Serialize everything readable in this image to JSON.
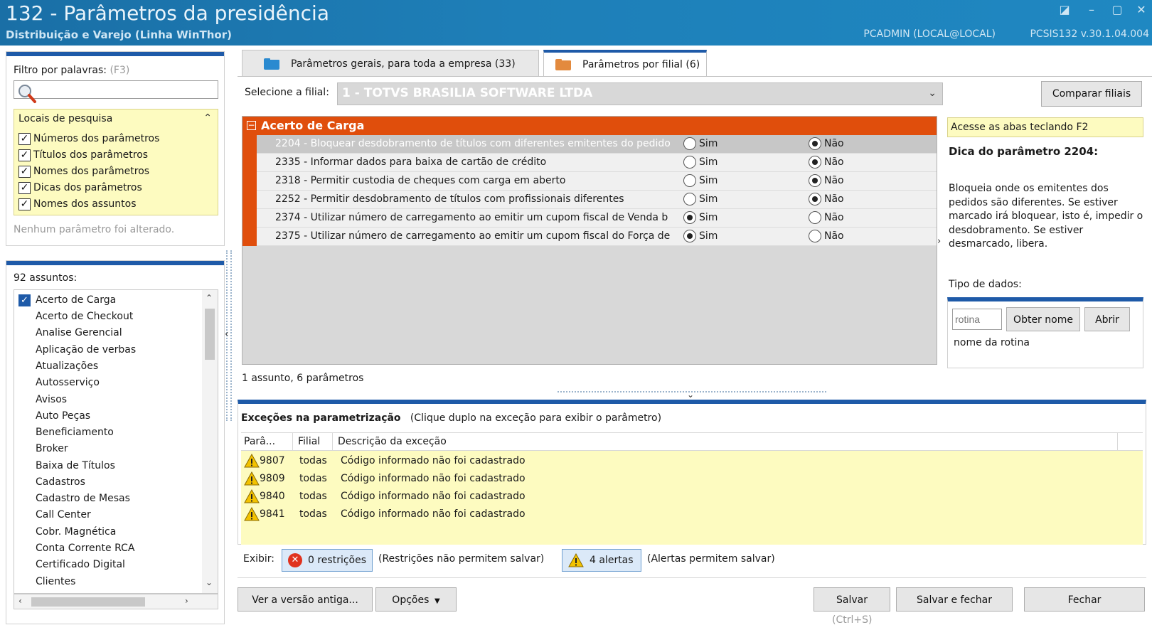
{
  "window": {
    "title": "132 - Parâmetros da presidência",
    "subtitle": "Distribuição e Varejo (Linha WinThor)",
    "user": "PCADMIN (LOCAL@LOCAL)",
    "version": "PCSIS132  v.30.1.04.004"
  },
  "filter": {
    "label": "Filtro por palavras:",
    "hint": "(F3)",
    "search_value": "",
    "locais_title": "Locais de pesquisa",
    "options": [
      {
        "label": "Números dos parâmetros",
        "checked": true
      },
      {
        "label": "Títulos dos parâmetros",
        "checked": true
      },
      {
        "label": "Nomes dos parâmetros",
        "checked": true
      },
      {
        "label": "Dicas dos parâmetros",
        "checked": true
      },
      {
        "label": "Nomes dos assuntos",
        "checked": true
      }
    ],
    "no_change": "Nenhum parâmetro foi alterado."
  },
  "assuntos": {
    "count_label": "92 assuntos:",
    "items": [
      "Acerto de Carga",
      "Acerto de Checkout",
      "Analise Gerencial",
      "Aplicação de verbas",
      "Atualizações",
      "Autosserviço",
      "Avisos",
      "Auto Peças",
      "Beneficiamento",
      "Broker",
      "Baixa de Títulos",
      "Cadastros",
      "Cadastro de Mesas",
      "Call Center",
      "Cobr. Magnética",
      "Conta Corrente RCA",
      "Certificado Digital",
      "Clientes"
    ]
  },
  "tabs": [
    {
      "label": "Parâmetros gerais, para toda a empresa  (33)",
      "active": false
    },
    {
      "label": "Parâmetros por filial  (6)",
      "active": true
    }
  ],
  "filial": {
    "label": "Selecione a filial:",
    "value": "1 - TOTVS BRASILIA SOFTWARE LTDA",
    "compare_label": "Comparar filiais"
  },
  "params": {
    "group": "Acerto de Carga",
    "yes_label": "Sim",
    "no_label": "Não",
    "rows": [
      {
        "desc": "2204 - Bloquear desdobramento de títulos com diferentes emitentes do pedido",
        "value": "no",
        "selected": true
      },
      {
        "desc": "2335 - Informar dados para baixa de cartão de crédito",
        "value": "no",
        "selected": false
      },
      {
        "desc": "2318 - Permitir custodia de cheques com carga em aberto",
        "value": "no",
        "selected": false
      },
      {
        "desc": "2252 - Permitir desdobramento de títulos com profissionais diferentes",
        "value": "no",
        "selected": false
      },
      {
        "desc": "2374 - Utilizar número de carregamento ao emitir um cupom fiscal de Venda b",
        "value": "yes",
        "selected": false
      },
      {
        "desc": "2375 - Utilizar número de carregamento ao emitir um cupom fiscal do Força de",
        "value": "yes",
        "selected": false
      }
    ],
    "footer": "1 assunto, 6 parâmetros"
  },
  "help": {
    "hint": "Acesse as abas teclando F2",
    "title": "Dica do parâmetro 2204:",
    "text": "Bloqueia onde os emitentes dos pedidos são diferentes. Se estiver marcado irá bloquear, isto é, impedir o desdobramento. Se estiver desmarcado, libera.",
    "type_label": "Tipo de dados:",
    "rotina_placeholder": "rotina",
    "obter_label": "Obter nome",
    "abrir_label": "Abrir",
    "rotina_name": "nome da rotina"
  },
  "exceptions": {
    "title": "Exceções na parametrização",
    "subtitle": "(Clique duplo na exceção para exibir o parâmetro)",
    "columns": [
      "Parâ...",
      "Filial",
      "Descrição da exceção"
    ],
    "rows": [
      {
        "param": "9807",
        "filial": "todas",
        "desc": "Código informado não foi cadastrado"
      },
      {
        "param": "9809",
        "filial": "todas",
        "desc": "Código informado não foi cadastrado"
      },
      {
        "param": "9840",
        "filial": "todas",
        "desc": "Código informado não foi cadastrado"
      },
      {
        "param": "9841",
        "filial": "todas",
        "desc": "Código informado não foi cadastrado"
      }
    ],
    "exibir_label": "Exibir:",
    "restr_label": "0 restrições",
    "restr_note": "(Restrições não permitem salvar)",
    "alert_label": "4 alertas",
    "alert_note": "(Alertas permitem salvar)"
  },
  "buttons": {
    "ver": "Ver a versão antiga...",
    "opcoes": "Opções",
    "salvar": "Salvar",
    "salvar_fechar": "Salvar e fechar",
    "fechar": "Fechar",
    "shortcut": "(Ctrl+S)"
  },
  "colors": {
    "accent": "#1e5aa8",
    "group": "#e04e0c",
    "highlight": "#fdfbc0"
  }
}
